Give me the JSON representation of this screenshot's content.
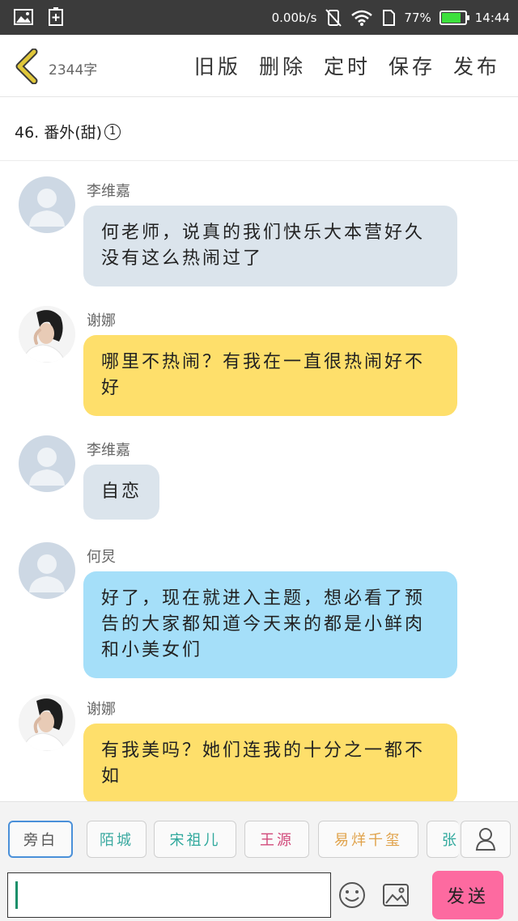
{
  "status_bar": {
    "net_speed": "0.00b/s",
    "battery_percent": "77%",
    "battery_level": 0.77,
    "time": "14:44",
    "icons": [
      "image-icon",
      "add-icon",
      "mute-icon",
      "wifi-icon",
      "sim-icon",
      "battery-icon"
    ]
  },
  "header": {
    "word_count": "2344字",
    "actions": [
      "旧版",
      "删除",
      "定时",
      "保存",
      "发布"
    ]
  },
  "chapter": {
    "title": "46. 番外(甜)",
    "badge": "1"
  },
  "messages": [
    {
      "sender": "李维嘉",
      "avatar": "default-avatar",
      "color": "grey",
      "text": "何老师，说真的我们快乐大本营好久没有这么热闹过了"
    },
    {
      "sender": "谢娜",
      "avatar": "photo-avatar",
      "color": "yellow",
      "text": "哪里不热闹？有我在一直很热闹好不好"
    },
    {
      "sender": "李维嘉",
      "avatar": "default-avatar",
      "color": "grey",
      "text": "自恋"
    },
    {
      "sender": "何炅",
      "avatar": "default-avatar",
      "color": "blue",
      "text": "好了，现在就进入主题，想必看了预告的大家都知道今天来的都是小鲜肉和小美女们"
    },
    {
      "sender": "谢娜",
      "avatar": "photo-avatar",
      "color": "yellow",
      "text": "有我美吗？她们连我的十分之一都不如"
    }
  ],
  "roles": [
    {
      "label": "旁白",
      "color": "#555555",
      "active": true
    },
    {
      "label": "陌城",
      "color": "#3aa9a0"
    },
    {
      "label": "宋祖儿",
      "color": "#2fa89c"
    },
    {
      "label": "王源",
      "color": "#d1497a"
    },
    {
      "label": "易烊千玺",
      "color": "#e0a24a"
    },
    {
      "label": "张",
      "color": "#2fa89c"
    }
  ],
  "input": {
    "placeholder": "",
    "send_label": "发送"
  },
  "colors": {
    "bubble_grey": "#dbe4ec",
    "bubble_yellow": "#fedf6b",
    "bubble_blue": "#a5dff9",
    "send_button": "#fd6aa0",
    "back_arrow": "#e0c73a"
  }
}
